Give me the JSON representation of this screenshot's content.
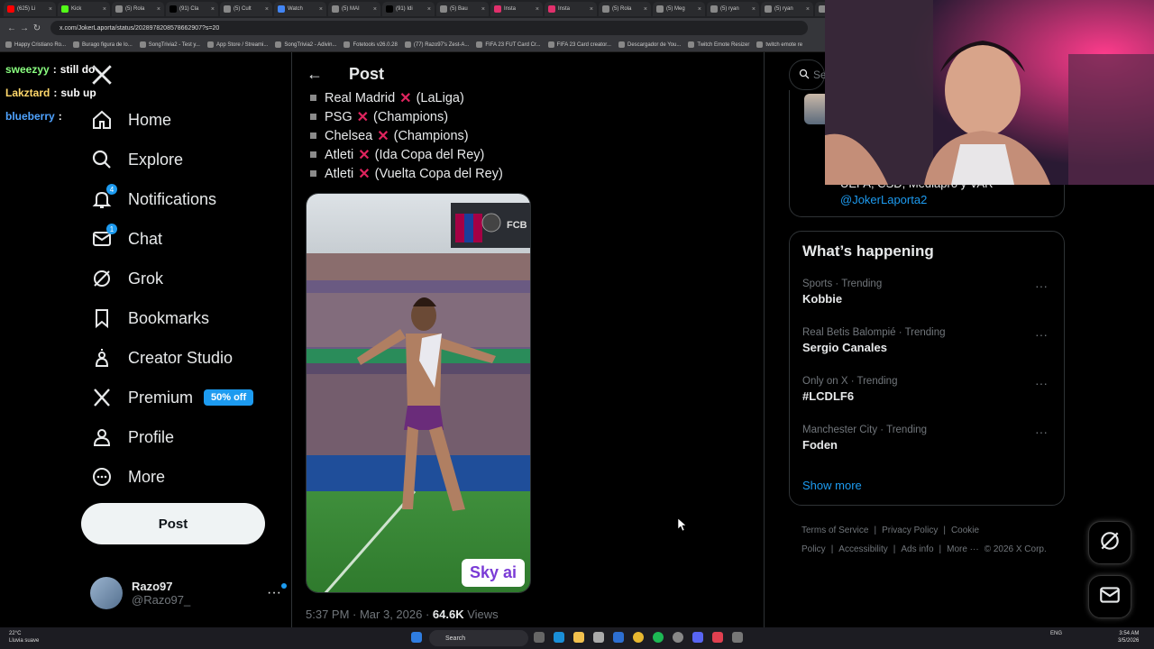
{
  "browser": {
    "tabs": [
      {
        "label": "(625) Li",
        "color": "#ff0000"
      },
      {
        "label": "Kick",
        "color": "#53fc18"
      },
      {
        "label": "(5) Rola",
        "color": "#888888"
      },
      {
        "label": "(91) Cla",
        "color": "#000000"
      },
      {
        "label": "(5) Cult",
        "color": "#888888"
      },
      {
        "label": "Watch",
        "color": "#4285f4"
      },
      {
        "label": "(5) MAI",
        "color": "#888888"
      },
      {
        "label": "(91) Idi",
        "color": "#000000"
      },
      {
        "label": "(5) Bau",
        "color": "#888888"
      },
      {
        "label": "Insta",
        "color": "#e1306c"
      },
      {
        "label": "Insta",
        "color": "#e1306c"
      },
      {
        "label": "(5) Rola",
        "color": "#888888"
      },
      {
        "label": "(5) Meg",
        "color": "#888888"
      },
      {
        "label": "(5) ryan",
        "color": "#888888"
      },
      {
        "label": "(5) ryan",
        "color": "#888888"
      },
      {
        "label": "(5) G",
        "color": "#888888"
      }
    ],
    "url": "x.com/JokerLaporta/status/2028978208578662907?s=20",
    "bookmarks": [
      "Happy Cristiano Ro...",
      "Burago figura de lo...",
      "SongTrivia2 - Test y...",
      "App Store / Streami...",
      "SongTrivia2 - Adivin...",
      "Fotetools v26.0.28",
      "(77) Razo97's Zest-A...",
      "FIFA 23 FUT Card Cr...",
      "FIFA 23 Card creator...",
      "Descargador de You...",
      "Twitch Emote Resizer",
      "twitch emote re"
    ]
  },
  "chat": [
    {
      "user": "sweezyy",
      "message": "still do"
    },
    {
      "user": "Lakztard",
      "message": "sub up"
    },
    {
      "user": "blueberry",
      "message": ""
    }
  ],
  "nav": {
    "items": [
      {
        "key": "home",
        "label": "Home"
      },
      {
        "key": "explore",
        "label": "Explore"
      },
      {
        "key": "notifications",
        "label": "Notifications",
        "badge": "4"
      },
      {
        "key": "chat",
        "label": "Chat",
        "badge": "1"
      },
      {
        "key": "grok",
        "label": "Grok"
      },
      {
        "key": "bookmarks",
        "label": "Bookmarks"
      },
      {
        "key": "creator-studio",
        "label": "Creator Studio"
      },
      {
        "key": "premium",
        "label": "Premium",
        "promo": "50% off"
      },
      {
        "key": "profile",
        "label": "Profile"
      },
      {
        "key": "more",
        "label": "More"
      }
    ],
    "post_button": "Post",
    "account": {
      "name": "Razo97",
      "handle": "@Razo97_"
    }
  },
  "post": {
    "header": "Post",
    "lines": [
      {
        "team": "Real Madrid",
        "comp": "(LaLiga)"
      },
      {
        "team": "PSG",
        "comp": "(Champions)"
      },
      {
        "team": "Chelsea",
        "comp": "(Champions)"
      },
      {
        "team": "Atleti",
        "comp": "(Ida Copa del Rey)"
      },
      {
        "team": "Atleti",
        "comp": "(Vuelta Copa del Rey)"
      }
    ],
    "media_watermark": "Sky ai",
    "stadium_screen": "FCB",
    "time": "5:37 PM · Mar 3, 2026 · ",
    "views_count": "64.6K",
    "views_label": " Views"
  },
  "right": {
    "search_placeholder": "Se",
    "prev_card": {
      "text": "UEFA, CSD, Mediapro y VAR",
      "link": "@JokerLaporta2"
    },
    "trends_title": "What’s happening",
    "trends": [
      {
        "category": "Sports · Trending",
        "name": "Kobbie"
      },
      {
        "category": "Real Betis Balompié · Trending",
        "name": "Sergio Canales"
      },
      {
        "category": "Only on X · Trending",
        "name": "#LCDLF6"
      },
      {
        "category": "Manchester City · Trending",
        "name": "Foden"
      }
    ],
    "show_more": "Show more",
    "footer": [
      "Terms of Service",
      "|",
      "Privacy Policy",
      "|",
      "Cookie Policy",
      "|",
      "Accessibility",
      "|",
      "Ads info",
      "|",
      "More ···",
      "© 2026 X Corp."
    ]
  },
  "taskbar": {
    "weather_temp": "22°C",
    "weather_desc": "Lluvia suave",
    "search": "Search",
    "lang": "ENG",
    "time": "3:54 AM",
    "date": "3/5/2026"
  },
  "colors": {
    "accent": "#1d9bf0",
    "cross": "#e0245e",
    "background": "#000000"
  }
}
